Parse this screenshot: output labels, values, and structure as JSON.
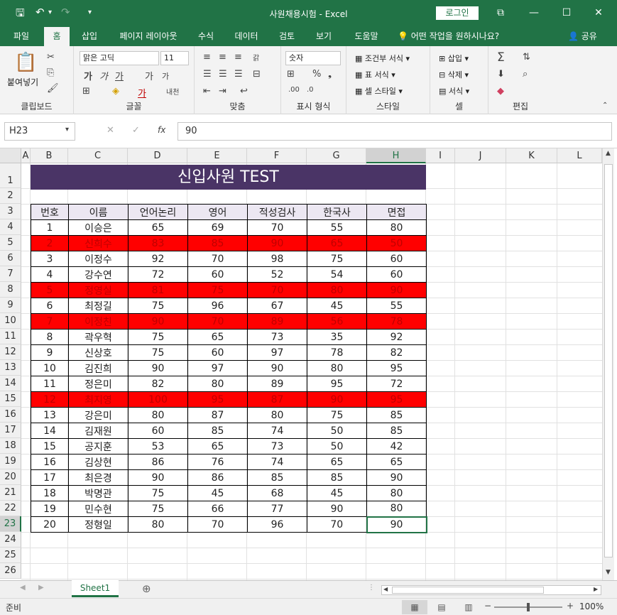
{
  "titlebar": {
    "title": "사원채용시험  -  Excel",
    "login": "로그인"
  },
  "tabs": [
    {
      "label": "파일"
    },
    {
      "label": "홈"
    },
    {
      "label": "삽입"
    },
    {
      "label": "페이지 레이아웃"
    },
    {
      "label": "수식"
    },
    {
      "label": "데이터"
    },
    {
      "label": "검토"
    },
    {
      "label": "보기"
    },
    {
      "label": "도움말"
    }
  ],
  "tell_me": "어떤 작업을 원하시나요?",
  "share": "공유",
  "ribbon": {
    "clipboard": {
      "paste": "붙여넣기",
      "label": "클립보드"
    },
    "font": {
      "name": "맑은 고딕",
      "size": "11",
      "label": "글꼴"
    },
    "align": {
      "label": "맞춤"
    },
    "number": {
      "format": "숫자",
      "label": "표시 형식"
    },
    "styles": {
      "cond": "조건부 서식",
      "table": "표 서식",
      "cell": "셀 스타일",
      "label": "스타일"
    },
    "cells": {
      "insert": "삽입",
      "delete": "삭제",
      "format": "서식",
      "label": "셀"
    },
    "edit": {
      "label": "편집"
    }
  },
  "formula_bar": {
    "name_box": "H23",
    "value": "90"
  },
  "columns": [
    "A",
    "B",
    "C",
    "D",
    "E",
    "F",
    "G",
    "H",
    "I",
    "J",
    "K",
    "L"
  ],
  "rows": [
    "1",
    "2",
    "3",
    "4",
    "5",
    "6",
    "7",
    "8",
    "9",
    "10",
    "11",
    "12",
    "13",
    "14",
    "15",
    "16",
    "17",
    "18",
    "19",
    "20",
    "21",
    "22",
    "23",
    "24",
    "25",
    "26"
  ],
  "sheet_title": "신입사원 TEST",
  "table": {
    "headers": [
      "번호",
      "이름",
      "언어논리",
      "영어",
      "적성검사",
      "한국사",
      "면접"
    ],
    "rows": [
      {
        "cells": [
          "1",
          "이승은",
          "65",
          "69",
          "70",
          "55",
          "80"
        ],
        "highlight": false
      },
      {
        "cells": [
          "2",
          "신희수",
          "83",
          "85",
          "90",
          "65",
          "50"
        ],
        "highlight": true
      },
      {
        "cells": [
          "3",
          "이정수",
          "92",
          "70",
          "98",
          "75",
          "60"
        ],
        "highlight": false
      },
      {
        "cells": [
          "4",
          "강수연",
          "72",
          "60",
          "52",
          "54",
          "60"
        ],
        "highlight": false
      },
      {
        "cells": [
          "5",
          "정영실",
          "81",
          "75",
          "70",
          "80",
          "90"
        ],
        "highlight": true
      },
      {
        "cells": [
          "6",
          "최정길",
          "75",
          "96",
          "67",
          "45",
          "55"
        ],
        "highlight": false
      },
      {
        "cells": [
          "7",
          "이정친",
          "90",
          "70",
          "89",
          "56",
          "78"
        ],
        "highlight": true
      },
      {
        "cells": [
          "8",
          "곽우혁",
          "75",
          "65",
          "73",
          "35",
          "92"
        ],
        "highlight": false
      },
      {
        "cells": [
          "9",
          "신상호",
          "75",
          "60",
          "97",
          "78",
          "82"
        ],
        "highlight": false
      },
      {
        "cells": [
          "10",
          "김진희",
          "90",
          "97",
          "90",
          "80",
          "95"
        ],
        "highlight": false
      },
      {
        "cells": [
          "11",
          "정은미",
          "82",
          "80",
          "89",
          "95",
          "72"
        ],
        "highlight": false
      },
      {
        "cells": [
          "12",
          "최지영",
          "100",
          "95",
          "87",
          "90",
          "95"
        ],
        "highlight": true
      },
      {
        "cells": [
          "13",
          "강은미",
          "80",
          "87",
          "80",
          "75",
          "85"
        ],
        "highlight": false
      },
      {
        "cells": [
          "14",
          "김재원",
          "60",
          "85",
          "74",
          "50",
          "85"
        ],
        "highlight": false
      },
      {
        "cells": [
          "15",
          "공지훈",
          "53",
          "65",
          "73",
          "50",
          "42"
        ],
        "highlight": false
      },
      {
        "cells": [
          "16",
          "김상현",
          "86",
          "76",
          "74",
          "65",
          "65"
        ],
        "highlight": false
      },
      {
        "cells": [
          "17",
          "최은경",
          "90",
          "86",
          "85",
          "85",
          "90"
        ],
        "highlight": false
      },
      {
        "cells": [
          "18",
          "박명관",
          "75",
          "45",
          "68",
          "45",
          "80"
        ],
        "highlight": false
      },
      {
        "cells": [
          "19",
          "민수현",
          "75",
          "66",
          "77",
          "90",
          "80"
        ],
        "highlight": false
      },
      {
        "cells": [
          "20",
          "정형일",
          "80",
          "70",
          "96",
          "70",
          "90"
        ],
        "highlight": false
      }
    ]
  },
  "sheet_tab": "Sheet1",
  "status": {
    "ready": "준비",
    "zoom": "100%"
  },
  "colors": {
    "accent": "#217346",
    "title_fill": "#4a3466",
    "header_fill": "#ece7f2",
    "highlight_fill": "#ff0000"
  }
}
